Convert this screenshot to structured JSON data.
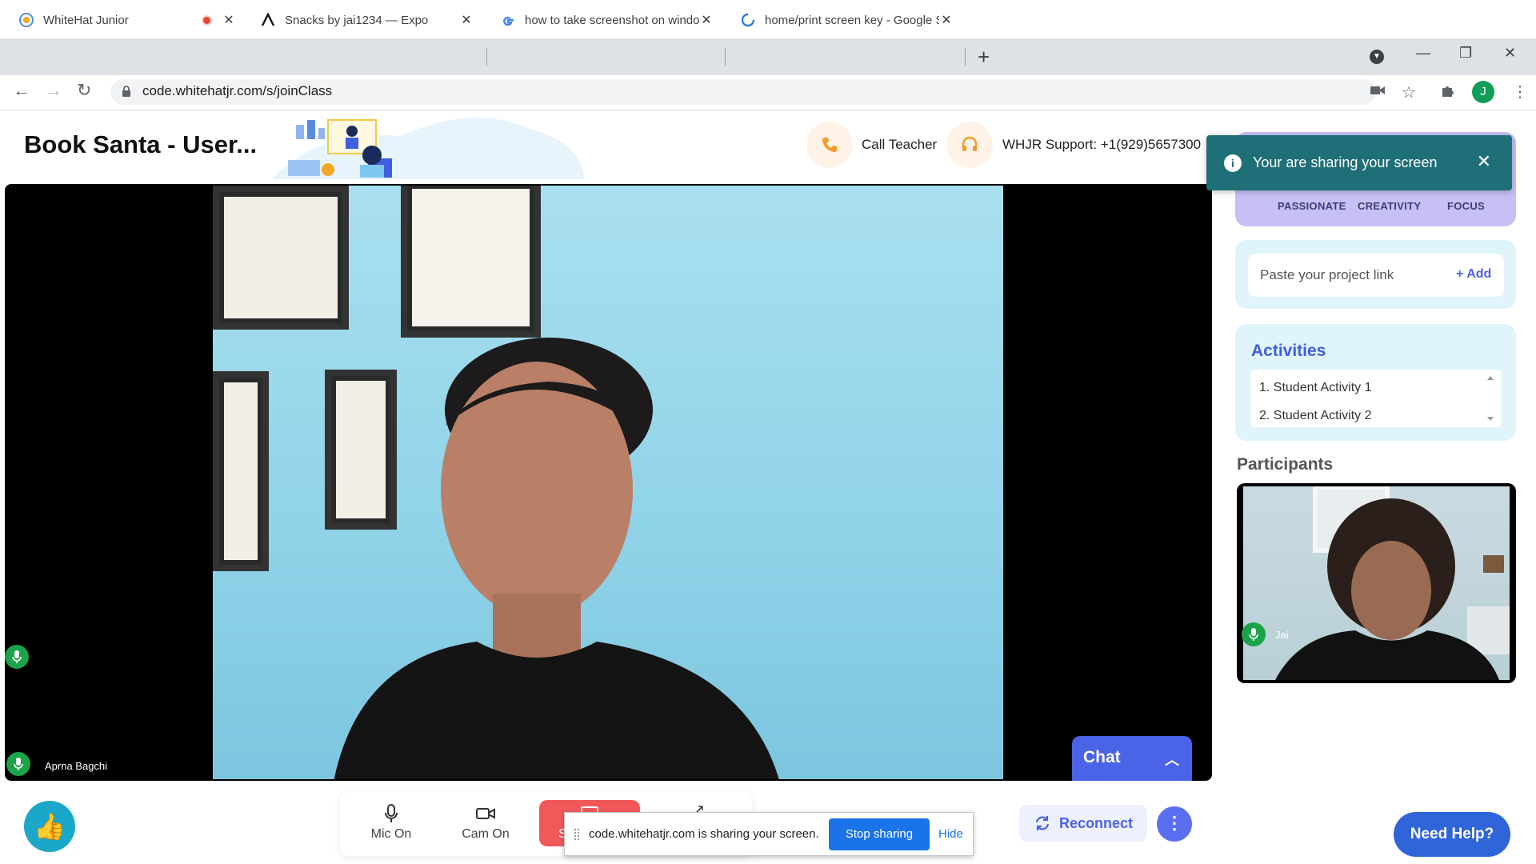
{
  "browser": {
    "tabs": [
      {
        "title": "WhiteHat Junior",
        "active": true,
        "recording": true
      },
      {
        "title": "Snacks by jai1234 — Expo",
        "active": false
      },
      {
        "title": "how to take screenshot on windo",
        "active": false
      },
      {
        "title": "home/print screen key - Google S",
        "active": false
      }
    ],
    "url": "code.whitehatjr.com/s/joinClass",
    "profile_initial": "J"
  },
  "header": {
    "title": "Book Santa - User...",
    "call_teacher": "Call Teacher",
    "support": "WHJR Support: +1(929)5657300"
  },
  "main_video": {
    "name": "Aprna Bagchi",
    "chat_label": "Chat"
  },
  "toast": {
    "message": "Your are sharing your screen"
  },
  "values": {
    "items": [
      "PASSIONATE",
      "CREATIVITY",
      "FOCUS"
    ]
  },
  "project_link": {
    "placeholder": "Paste your project link",
    "add_label": "+ Add"
  },
  "activities": {
    "title": "Activities",
    "items": [
      "1. Student Activity 1",
      "2. Student Activity 2"
    ]
  },
  "participants": {
    "title": "Participants",
    "items": [
      {
        "name": "Jai"
      }
    ]
  },
  "controls": {
    "mic": "Mic On",
    "cam": "Cam On",
    "share_partial": "S",
    "reconnect": "Reconnect",
    "need_help": "Need Help?"
  },
  "share_bar": {
    "message": "code.whitehatjr.com is sharing your screen.",
    "stop": "Stop sharing",
    "hide": "Hide"
  },
  "colors": {
    "accent": "#4a63e7",
    "toast": "#1f6f78",
    "share_red": "#f0585a",
    "mic_green": "#1ba34a"
  }
}
